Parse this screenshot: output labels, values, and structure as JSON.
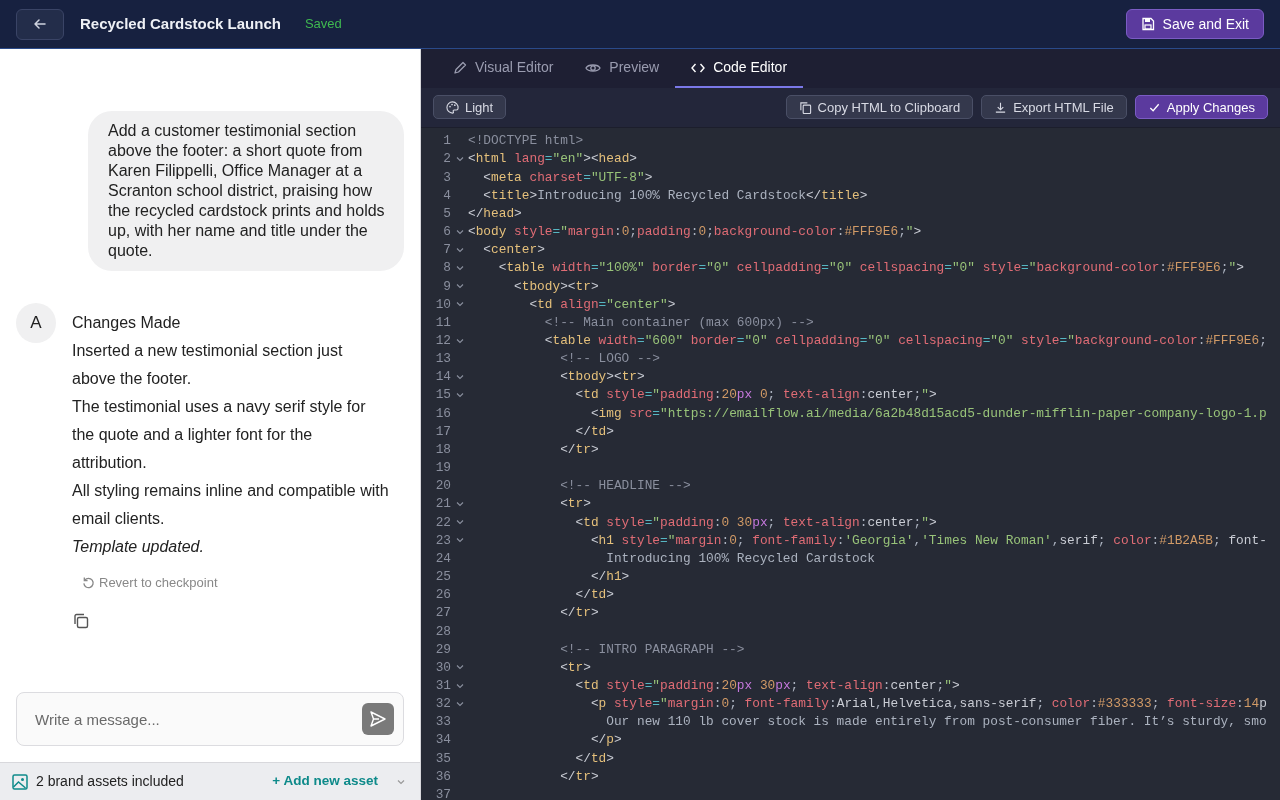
{
  "header": {
    "title": "Recycled Cardstock Launch",
    "status": "Saved",
    "save_button": "Save and Exit"
  },
  "chat": {
    "user_message": "Add a customer testimonial section above the footer: a short quote from Karen Filippelli, Office Manager at a Scranton school district, praising how the recycled cardstock prints and holds up, with her name and title under the quote.",
    "assistant": {
      "avatar": "A",
      "paragraphs": [
        {
          "kind": "heading",
          "text": "Changes Made"
        },
        {
          "kind": "plain",
          "text": "Inserted a new testimonial section just above the footer."
        },
        {
          "kind": "plain",
          "text": "The testimonial uses a navy serif style for the quote and a lighter font for the attribution."
        },
        {
          "kind": "plain",
          "text": "All styling remains inline and compatible with email clients."
        },
        {
          "kind": "italic",
          "text": "Template updated."
        }
      ],
      "revert_link": "Revert to checkpoint"
    }
  },
  "composer": {
    "placeholder": "Write a message..."
  },
  "assets_bar": {
    "text": "2 brand assets included",
    "add_link": "+ Add new asset"
  },
  "editor": {
    "tabs": [
      {
        "label": "Visual Editor",
        "selected": false
      },
      {
        "label": "Preview",
        "selected": false
      },
      {
        "label": "Code Editor",
        "selected": true
      }
    ],
    "theme_button": "Light",
    "actions": [
      {
        "label": "Copy HTML to Clipboard",
        "kind": "copy"
      },
      {
        "label": "Export HTML File",
        "kind": "download"
      },
      {
        "label": "Apply Changes",
        "kind": "apply"
      }
    ],
    "code_lines": [
      {
        "number": "1",
        "text": "<!DOCTYPE html>",
        "foldable": false
      },
      {
        "number": "2",
        "text": "<html lang=\"en\"><head>",
        "foldable": true
      },
      {
        "number": "3",
        "text": "  <meta charset=\"UTF-8\">",
        "foldable": false
      },
      {
        "number": "4",
        "text": "  <title>Introducing 100% Recycled Cardstock</title>",
        "foldable": false
      },
      {
        "number": "5",
        "text": "</head>",
        "foldable": false
      },
      {
        "number": "6",
        "text": "<body style=\"margin:0;padding:0;background-color:#FFF9E6;\">",
        "foldable": true
      },
      {
        "number": "7",
        "text": "  <center>",
        "foldable": true
      },
      {
        "number": "8",
        "text": "    <table width=\"100%\" border=\"0\" cellpadding=\"0\" cellspacing=\"0\" style=\"background-color:#FFF9E6;\">",
        "foldable": true
      },
      {
        "number": "9",
        "text": "      <tbody><tr>",
        "foldable": true
      },
      {
        "number": "10",
        "text": "        <td align=\"center\">",
        "foldable": true
      },
      {
        "number": "11",
        "text": "          <!-- Main container (max 600px) -->",
        "foldable": false
      },
      {
        "number": "12",
        "text": "          <table width=\"600\" border=\"0\" cellpadding=\"0\" cellspacing=\"0\" style=\"background-color:#FFF9E6;",
        "foldable": true
      },
      {
        "number": "13",
        "text": "            <!-- LOGO -->",
        "foldable": false
      },
      {
        "number": "14",
        "text": "            <tbody><tr>",
        "foldable": true
      },
      {
        "number": "15",
        "text": "              <td style=\"padding:20px 0; text-align:center;\">",
        "foldable": true
      },
      {
        "number": "16",
        "text": "                <img src=\"https://emailflow.ai/media/6a2b48d15acd5-dunder-mifflin-paper-company-logo-1.p",
        "foldable": false
      },
      {
        "number": "17",
        "text": "              </td>",
        "foldable": false
      },
      {
        "number": "18",
        "text": "            </tr>",
        "foldable": false
      },
      {
        "number": "19",
        "foldable": false
      },
      {
        "number": "20",
        "text": "            <!-- HEADLINE -->",
        "foldable": false
      },
      {
        "number": "21",
        "text": "            <tr>",
        "foldable": true
      },
      {
        "number": "22",
        "text": "              <td style=\"padding:0 30px; text-align:center;\">",
        "foldable": true
      },
      {
        "number": "23",
        "text": "                <h1 style=\"margin:0; font-family:'Georgia','Times New Roman',serif; color:#1B2A5B; font-",
        "foldable": true
      },
      {
        "number": "24",
        "text": "                  Introducing 100% Recycled Cardstock",
        "foldable": false
      },
      {
        "number": "25",
        "text": "                </h1>",
        "foldable": false
      },
      {
        "number": "26",
        "text": "              </td>",
        "foldable": false
      },
      {
        "number": "27",
        "text": "            </tr>",
        "foldable": false
      },
      {
        "number": "28",
        "foldable": false
      },
      {
        "number": "29",
        "text": "            <!-- INTRO PARAGRAPH -->",
        "foldable": false
      },
      {
        "number": "30",
        "text": "            <tr>",
        "foldable": true
      },
      {
        "number": "31",
        "text": "              <td style=\"padding:20px 30px; text-align:center;\">",
        "foldable": true
      },
      {
        "number": "32",
        "text": "                <p style=\"margin:0; font-family:Arial,Helvetica,sans-serif; color:#333333; font-size:14p",
        "foldable": true
      },
      {
        "number": "33",
        "text": "                  Our new 110 lb cover stock is made entirely from post-consumer fiber. It’s sturdy, smo",
        "foldable": false
      },
      {
        "number": "34",
        "text": "                </p>",
        "foldable": false
      },
      {
        "number": "35",
        "text": "              </td>",
        "foldable": false
      },
      {
        "number": "36",
        "text": "            </tr>",
        "foldable": false
      },
      {
        "number": "37",
        "foldable": false
      }
    ]
  }
}
